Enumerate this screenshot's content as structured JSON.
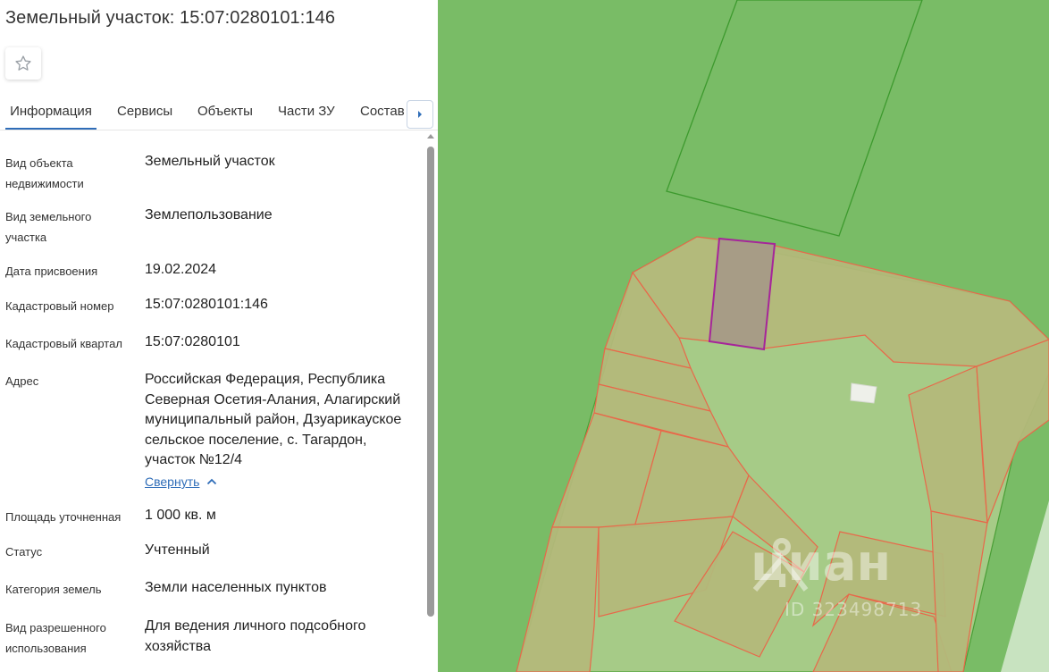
{
  "header": {
    "title": "Земельный участок: 15:07:0280101:146"
  },
  "favorite": {
    "icon": "star-outline-icon"
  },
  "tabs": {
    "items": [
      {
        "label": "Информация",
        "active": true
      },
      {
        "label": "Сервисы",
        "active": false
      },
      {
        "label": "Объекты",
        "active": false
      },
      {
        "label": "Части ЗУ",
        "active": false
      },
      {
        "label": "Состав",
        "active": false
      }
    ],
    "next_icon": "chevron-right-icon"
  },
  "info": {
    "rows": [
      {
        "label": "Вид объекта недвижимости",
        "value": "Земельный участок"
      },
      {
        "label": "Вид земельного участка",
        "value": "Землепользование"
      },
      {
        "label": "Дата присвоения",
        "value": "19.02.2024"
      },
      {
        "label": "Кадастровый номер",
        "value": "15:07:0280101:146"
      },
      {
        "label": "Кадастровый квартал",
        "value": "15:07:0280101"
      },
      {
        "label": "Адрес",
        "value": "Российская Федерация, Республика Северная Осетия-Алания, Алагирский муниципальный район, Дзуарикауское сельское поселение, с. Тагардон, участок №12/4"
      },
      {
        "label": "Площадь уточненная",
        "value": "1 000 кв. м"
      },
      {
        "label": "Статус",
        "value": "Учтенный"
      },
      {
        "label": "Категория земель",
        "value": "Земли населенных пунктов"
      },
      {
        "label": "Вид разрешенного использования",
        "value": "Для ведения личного подсобного хозяйства"
      }
    ],
    "collapse_label": "Свернуть"
  },
  "map": {
    "watermark": "циан",
    "watermark_id": "ID 323498713",
    "colors": {
      "background": "#79bc66",
      "quarter_fill": "#a6cb87",
      "parcel_fill": "#b3b87a",
      "parcel_stroke": "#e8684a",
      "selected_fill": "#a79c86",
      "selected_stroke": "#a6259a",
      "road_fill": "#c8e3c0"
    }
  }
}
